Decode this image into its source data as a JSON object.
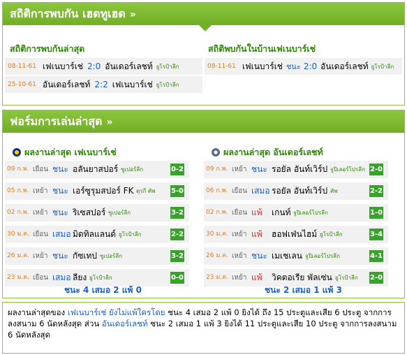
{
  "h2h": {
    "title": "สถิติการพบกัน เฮดทูเฮด",
    "chevron": "»",
    "latest_title": "สถิติการพบกันล่าสุด",
    "home_title": "สถิติพบกันในบ้านเฟเนบาร์เช่",
    "latest": [
      {
        "date": "08-11-61",
        "home": "เฟเนบาร์เช่",
        "score": "2:0",
        "away": "อันเดอร์เลชท์",
        "comp": "ยูโรป้าลีก"
      },
      {
        "date": "25-10-61",
        "home": "อันเดอร์เลชท์",
        "score": "2:2",
        "away": "เฟเนบาร์เช่",
        "comp": "ยูโรป้าลีก"
      }
    ],
    "home": [
      {
        "date": "08-11-61",
        "home": "เฟเนบาร์เช่",
        "result": "ชนะ",
        "score": "2:0",
        "away": "อันเดอร์เลชท์",
        "comp": "ยูโรป้าลีก"
      }
    ]
  },
  "form": {
    "title": "ฟอร์มการเล่นล่าสุด",
    "chevron": "»",
    "left_title": "ผลงานล่าสุด เฟเนบาร์เช่",
    "right_title": "ผลงานล่าสุด อันเดอร์เลชท์",
    "left": [
      {
        "date": "09 ก.พ.",
        "ha": "เยือน",
        "res": "ชนะ",
        "opp": "อลันยาสปอร์",
        "comp": "ซูเปอร์ลีก",
        "score": "0-2"
      },
      {
        "date": "05 ก.พ.",
        "ha": "เหย้า",
        "res": "ชนะ",
        "opp": "เอร์ซูรุมสปอร์ FK",
        "comp": "ตุรกี คัพ",
        "score": "5-0"
      },
      {
        "date": "02 ก.พ.",
        "ha": "เหย้า",
        "res": "ชนะ",
        "opp": "ริเซสปอร์",
        "comp": "ซูเปอร์ลีก",
        "score": "3-2"
      },
      {
        "date": "30 ม.ค.",
        "ha": "เยือน",
        "res": "เสมอ",
        "opp": "มิดทิลแลนด์",
        "comp": "ยูโรป้าลีก",
        "score": "2-2"
      },
      {
        "date": "26 ม.ค.",
        "ha": "เหย้า",
        "res": "ชนะ",
        "opp": "กัซเทป",
        "comp": "ซูเปอร์ลีก",
        "score": "3-2"
      },
      {
        "date": "23 ม.ค.",
        "ha": "เยือน",
        "res": "เสมอ",
        "opp": "ลียง",
        "comp": "ยูโรป้าลีก",
        "score": "0-0"
      }
    ],
    "right": [
      {
        "date": "09 ก.พ.",
        "ha": "เหย้า",
        "res": "ชนะ",
        "opp": "รอยัล อันท์เวิร์ป",
        "comp": "จูปิเลอร์โปรลีก",
        "score": "2-0"
      },
      {
        "date": "06 ก.พ.",
        "ha": "เยือน",
        "res": "เสมอ",
        "opp": "รอยัล อันท์เวิร์ป",
        "comp": "คัพ",
        "score": "2-2"
      },
      {
        "date": "02 ก.พ.",
        "ha": "เยือน",
        "res": "แพ้",
        "opp": "เกนท์",
        "comp": "จูปิเลอร์โปรลีก",
        "score": "1-0"
      },
      {
        "date": "30 ม.ค.",
        "ha": "เหย้า",
        "res": "แพ้",
        "opp": "ฮอฟเฟ่นไฮม์",
        "comp": "ยูโรป้าลีก",
        "score": "3-4"
      },
      {
        "date": "26 ม.ค.",
        "ha": "เหย้า",
        "res": "ชนะ",
        "opp": "เมเชเลน",
        "comp": "จูปิเลอร์โปรลีก",
        "score": "4-1"
      },
      {
        "date": "23 ม.ค.",
        "ha": "เหย้า",
        "res": "แพ้",
        "opp": "วิคตอเรีย พัลเซ่น",
        "comp": "ยูโรป้าลีก",
        "score": "2-0"
      }
    ],
    "left_summary": "ชนะ 4 เสมอ 2 แพ้ 0",
    "right_summary": "ชนะ 2 เสมอ 1 แพ้ 3"
  },
  "note": {
    "p1": "ผลงานล่าสุดของ ",
    "team1": "เฟเนบาร์เช่ ยังไม่แพ้ใครโดย",
    "p2": " ชนะ 4 เสมอ 2 แพ้ 0 ยิงได้ ถึง 15 ประตูและเสีย 6 ประตู จากการลงสนาม 6 นัดหลังสุด ส่วน ",
    "team2": "อันเดอร์เลชท์",
    "p3": " ชนะ 2 เสมอ 1 แพ้ 3 ยิงได้ 11 ประตูและเสีย 10 ประตู จากการลงสนาม 6 นัดหลังสุด"
  }
}
